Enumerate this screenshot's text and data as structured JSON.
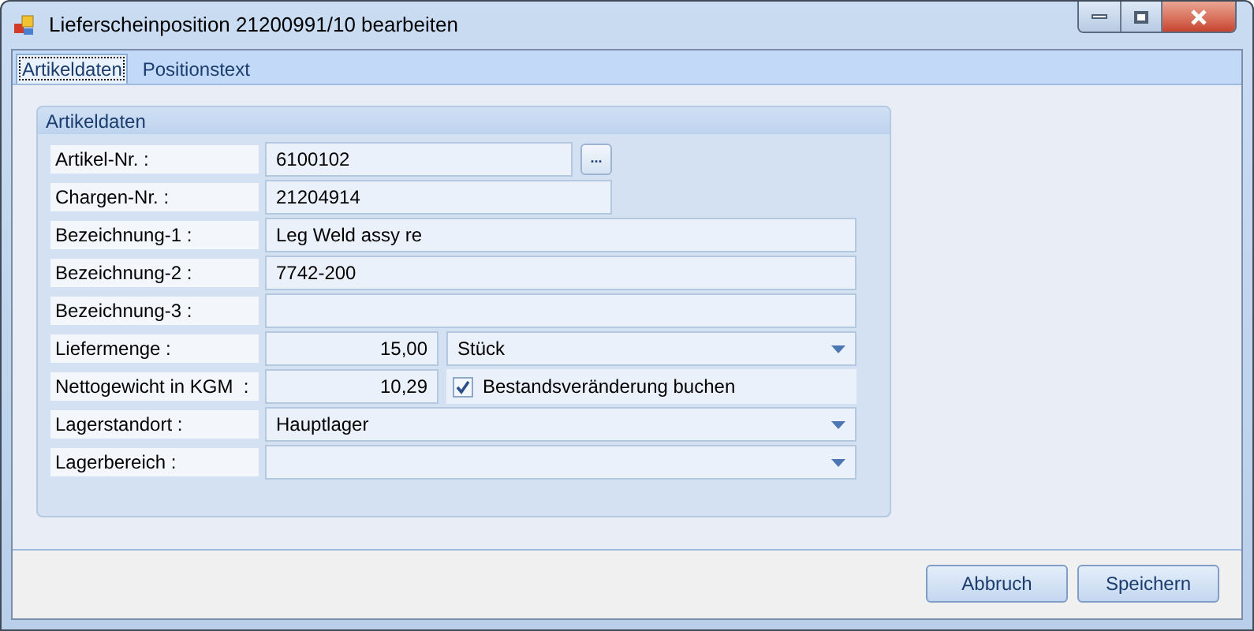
{
  "window": {
    "title": "Lieferscheinposition 21200991/10 bearbeiten"
  },
  "tabs": [
    {
      "label": "Artikeldaten",
      "selected": true
    },
    {
      "label": "Positionstext",
      "selected": false
    }
  ],
  "group": {
    "title": "Artikeldaten",
    "rows": [
      {
        "kind": "lookup",
        "label": "Artikel-Nr. :",
        "value": "6100102",
        "button": "..."
      },
      {
        "kind": "short_text",
        "label": "Chargen-Nr. :",
        "value": "21204914"
      },
      {
        "kind": "text",
        "label": "Bezeichnung-1 :",
        "value": "Leg Weld assy re"
      },
      {
        "kind": "text",
        "label": "Bezeichnung-2 :",
        "value": "7742-200"
      },
      {
        "kind": "text",
        "label": "Bezeichnung-3 :"
      },
      {
        "kind": "amount_unit",
        "label": "Liefermenge :",
        "amount": "15,00",
        "unit": "Stück"
      },
      {
        "kind": "amount_check",
        "label": "Nettogewicht in KGM  :",
        "amount": "10,29",
        "check_label": "Bestandsveränderung buchen",
        "checked": true
      },
      {
        "kind": "select",
        "label": "Lagerstandort :",
        "value": "Hauptlager"
      },
      {
        "kind": "select",
        "label": "Lagerbereich :"
      }
    ]
  },
  "buttons": [
    "Abbruch",
    "Speichern"
  ]
}
